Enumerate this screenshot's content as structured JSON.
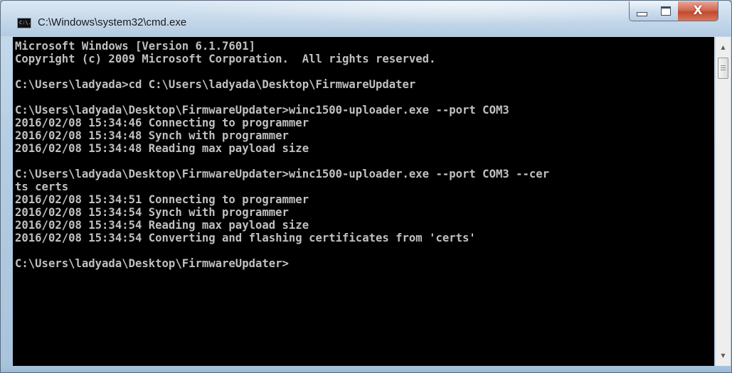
{
  "window": {
    "title": "C:\\Windows\\system32\\cmd.exe",
    "icon": "cmd-icon",
    "icon_text": "C:\\.",
    "controls": {
      "minimize_icon": "minimize-icon",
      "maximize_icon": "maximize-icon",
      "close_icon": "close-icon",
      "close_glyph": "X"
    }
  },
  "console": {
    "background": "#000000",
    "text_color": "#c0c0c0",
    "lines": [
      "Microsoft Windows [Version 6.1.7601]",
      "Copyright (c) 2009 Microsoft Corporation.  All rights reserved.",
      "",
      "C:\\Users\\ladyada>cd C:\\Users\\ladyada\\Desktop\\FirmwareUpdater",
      "",
      "C:\\Users\\ladyada\\Desktop\\FirmwareUpdater>winc1500-uploader.exe --port COM3",
      "2016/02/08 15:34:46 Connecting to programmer",
      "2016/02/08 15:34:48 Synch with programmer",
      "2016/02/08 15:34:48 Reading max payload size",
      "",
      "C:\\Users\\ladyada\\Desktop\\FirmwareUpdater>winc1500-uploader.exe --port COM3 --cer",
      "ts certs",
      "2016/02/08 15:34:51 Connecting to programmer",
      "2016/02/08 15:34:54 Synch with programmer",
      "2016/02/08 15:34:54 Reading max payload size",
      "2016/02/08 15:34:54 Converting and flashing certificates from 'certs'",
      "",
      "C:\\Users\\ladyada\\Desktop\\FirmwareUpdater>"
    ]
  },
  "scrollbar": {
    "up_icon": "scroll-up-arrow-icon",
    "down_icon": "scroll-down-arrow-icon",
    "up_glyph": "▲",
    "down_glyph": "▼"
  }
}
